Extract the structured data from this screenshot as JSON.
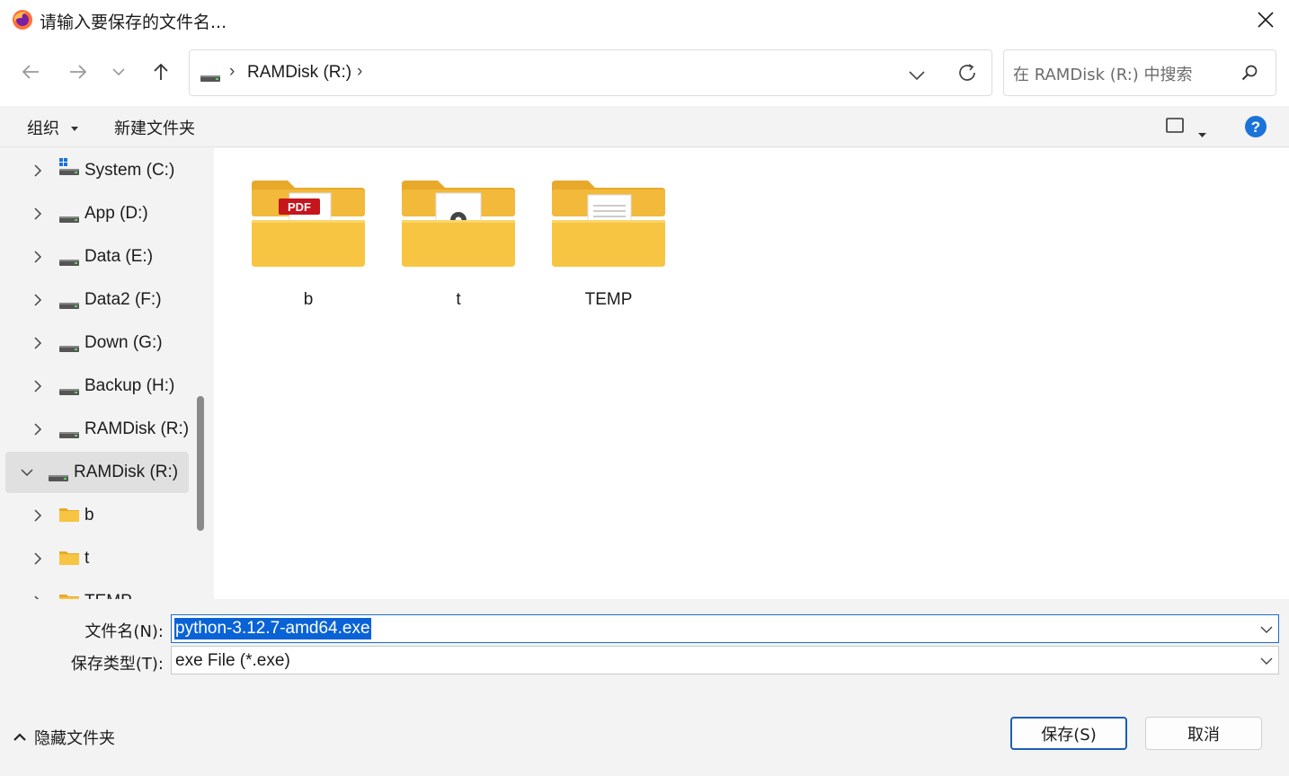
{
  "window": {
    "title": "请输入要保存的文件名..."
  },
  "navigation": {
    "breadcrumb_drive": "RAMDisk (R:)",
    "breadcrumb_separator": "›",
    "search_placeholder": "在 RAMDisk (R:) 中搜索"
  },
  "command_bar": {
    "organize_label": "组织",
    "new_folder_label": "新建文件夹"
  },
  "nav_pane": {
    "items": [
      {
        "label": "System (C:)",
        "icon": "windows-drive-icon",
        "expanded": false
      },
      {
        "label": "App (D:)",
        "icon": "drive-icon",
        "expanded": false
      },
      {
        "label": "Data (E:)",
        "icon": "drive-icon",
        "expanded": false
      },
      {
        "label": "Data2 (F:)",
        "icon": "drive-icon",
        "expanded": false
      },
      {
        "label": "Down (G:)",
        "icon": "drive-icon",
        "expanded": false
      },
      {
        "label": "Backup (H:)",
        "icon": "drive-icon",
        "expanded": false
      },
      {
        "label": "RAMDisk (R:)",
        "icon": "drive-icon",
        "expanded": false
      },
      {
        "label": "RAMDisk (R:)",
        "icon": "drive-icon",
        "expanded": true,
        "selected": true
      },
      {
        "label": "b",
        "icon": "folder-icon",
        "expanded": false
      },
      {
        "label": "t",
        "icon": "folder-icon",
        "expanded": false
      },
      {
        "label": "TEMP",
        "icon": "folder-icon",
        "expanded": false
      }
    ]
  },
  "content": {
    "folders": [
      {
        "name": "b",
        "preview": "pdf-document-icon"
      },
      {
        "name": "t",
        "preview": "settings-document-icon"
      },
      {
        "name": "TEMP",
        "preview": "text-document-icon"
      }
    ]
  },
  "fields": {
    "filename_label": "文件名(N):",
    "filename_value": "python-3.12.7-amd64.exe",
    "filetype_label": "保存类型(T):",
    "filetype_value": "exe File (*.exe)"
  },
  "footer": {
    "hide_folders_label": "隐藏文件夹",
    "save_label": "保存(S)",
    "cancel_label": "取消"
  },
  "colors": {
    "accent": "#0a63d6",
    "folder": "#f8c542",
    "help": "#1a73d9"
  }
}
